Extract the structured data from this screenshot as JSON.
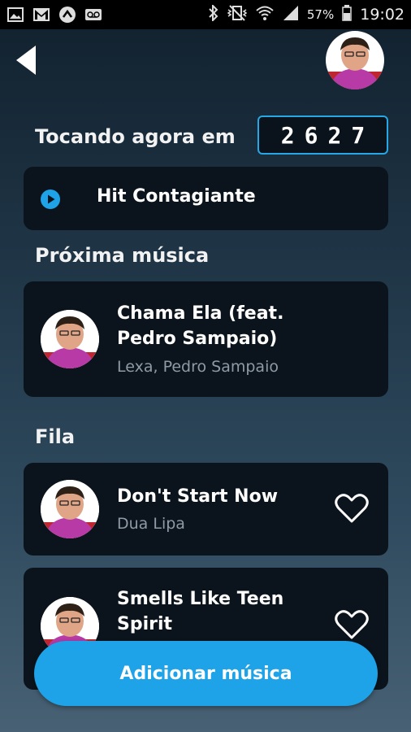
{
  "status_bar": {
    "left_icons": [
      "image-icon",
      "gmail-icon",
      "arrow-up-icon",
      "voicemail-icon"
    ],
    "right_icons": [
      "bluetooth-icon",
      "vibrate-icon",
      "wifi-icon",
      "signal-icon",
      "battery-icon"
    ],
    "battery": "57%",
    "time": "19:02"
  },
  "header": {
    "back_icon": "back-arrow-icon",
    "profile_icon": "user-avatar"
  },
  "now_playing": {
    "label": "Tocando agora em",
    "room_code": "2627",
    "song_title": "Hit Contagiante",
    "play_icon": "play-circle-icon"
  },
  "next": {
    "label": "Próxima música",
    "title_line1": "Chama Ela (feat.",
    "title_line2": "Pedro Sampaio)",
    "artist": "Lexa, Pedro Sampaio"
  },
  "queue": {
    "label": "Fila",
    "items": [
      {
        "title_line1": "Don't Start Now",
        "title_line2": "",
        "artist": "Dua Lipa"
      },
      {
        "title_line1": "Smells Like Teen",
        "title_line2": "Spirit",
        "artist": ""
      }
    ]
  },
  "add_button": {
    "label": "Adicionar música"
  },
  "colors": {
    "accent": "#1ea3e8",
    "card": "#0b141c",
    "secondary_text": "#8e9aa5"
  }
}
